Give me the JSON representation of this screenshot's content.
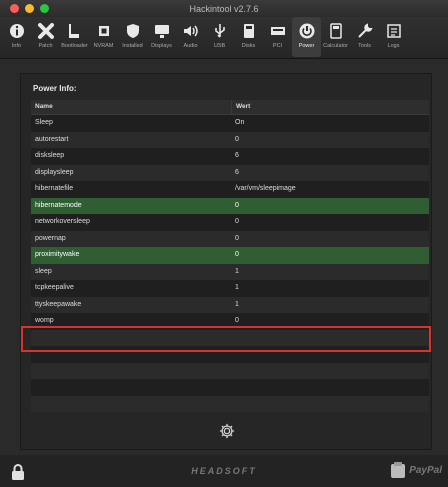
{
  "window": {
    "title": "Hackintool v2.7.6"
  },
  "toolbar": {
    "items": [
      {
        "label": "Info",
        "icon": "info-icon"
      },
      {
        "label": "Patch",
        "icon": "patch-icon"
      },
      {
        "label": "Bootloader",
        "icon": "boot-icon"
      },
      {
        "label": "NVRAM",
        "icon": "chip-icon"
      },
      {
        "label": "Installed",
        "icon": "shield-icon"
      },
      {
        "label": "Displays",
        "icon": "display-icon"
      },
      {
        "label": "Audio",
        "icon": "speaker-icon"
      },
      {
        "label": "USB",
        "icon": "usb-icon"
      },
      {
        "label": "Disks",
        "icon": "disk-icon"
      },
      {
        "label": "PCI",
        "icon": "pci-icon"
      },
      {
        "label": "Power",
        "icon": "power-icon"
      },
      {
        "label": "Calculator",
        "icon": "calculator-icon"
      },
      {
        "label": "Tools",
        "icon": "wrench-icon"
      },
      {
        "label": "Logs",
        "icon": "logs-icon"
      }
    ],
    "active": "Power"
  },
  "panel": {
    "title": "Power Info:",
    "columns": [
      "Name",
      "Wert"
    ],
    "rows": [
      [
        "Sleep",
        "On"
      ],
      [
        "autorestart",
        "0"
      ],
      [
        "disksleep",
        "6"
      ],
      [
        "displaysleep",
        "6"
      ],
      [
        "hibernatefile",
        "/var/vm/sleepimage"
      ],
      [
        "hibernatemode",
        "0"
      ],
      [
        "networkoversleep",
        "0"
      ],
      [
        "powernap",
        "0"
      ],
      [
        "proximitywake",
        "0"
      ],
      [
        "sleep",
        "1"
      ],
      [
        "tcpkeepalive",
        "1"
      ],
      [
        "ttyskeepawake",
        "1"
      ],
      [
        "womp",
        "0"
      ]
    ],
    "selected_rows": [
      5,
      8
    ],
    "highlighted_row": 8
  },
  "footer": {
    "brand": "HEADSOFT",
    "donate": "PayPal"
  },
  "colors": {
    "selection": "#2e5e32",
    "highlight_box": "#d8342c"
  }
}
